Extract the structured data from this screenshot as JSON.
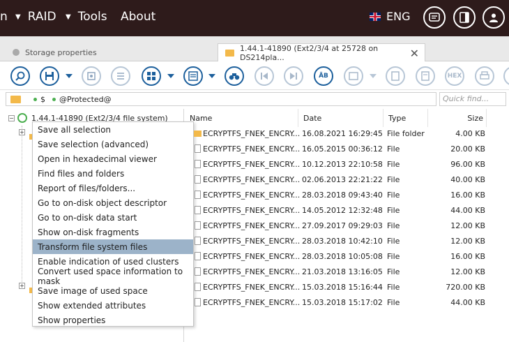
{
  "menubar": {
    "partial_item": "n",
    "items": [
      {
        "label": "RAID",
        "has_caret": true
      },
      {
        "label": "Tools",
        "has_caret": true
      },
      {
        "label": "About",
        "has_caret": false
      }
    ],
    "language": "ENG",
    "buttons": [
      "chat-icon",
      "panel-toggle-icon",
      "user-icon"
    ]
  },
  "tabs": [
    {
      "label": "Storage properties",
      "active": false
    },
    {
      "label": "1.44.1-41890 (Ext2/3/4 at 25728 on DS214pla...",
      "active": true
    }
  ],
  "toolbar": {
    "hex_label": "HEX",
    "ab_label": "ÄB"
  },
  "pathbar": {
    "segments": [
      "$",
      "@Protected@"
    ]
  },
  "quickfind": {
    "placeholder": "Quick find..."
  },
  "tree": {
    "root_label": "1.44.1-41890 (Ext2/3/4 file system)"
  },
  "context_menu": {
    "items": [
      "Save all selection",
      "Save selection (advanced)",
      "Open in hexadecimal viewer",
      "Find files and folders",
      "Report of files/folders...",
      "Go to on-disk object descriptor",
      "Go to on-disk data start",
      "Show on-disk fragments",
      "Transform file system files",
      "Enable indication of used clusters",
      "Convert used space information to mask",
      "Save image of used space",
      "Show extended attributes",
      "Show properties"
    ],
    "highlighted_index": 8
  },
  "filelist": {
    "columns": [
      "Name",
      "Date",
      "Type",
      "Size"
    ],
    "rows": [
      {
        "name": "ECRYPTFS_FNEK_ENCRY...",
        "date": "16.08.2021 16:29:45",
        "type": "File folder",
        "size": "4.00 KB",
        "icon": "folder"
      },
      {
        "name": "ECRYPTFS_FNEK_ENCRY...",
        "date": "16.05.2015 00:36:12",
        "type": "File",
        "size": "20.00 KB",
        "icon": "file"
      },
      {
        "name": "ECRYPTFS_FNEK_ENCRY...",
        "date": "10.12.2013 22:10:58",
        "type": "File",
        "size": "96.00 KB",
        "icon": "file"
      },
      {
        "name": "ECRYPTFS_FNEK_ENCRY...",
        "date": "02.06.2013 22:21:22",
        "type": "File",
        "size": "40.00 KB",
        "icon": "file"
      },
      {
        "name": "ECRYPTFS_FNEK_ENCRY...",
        "date": "28.03.2018 09:43:40",
        "type": "File",
        "size": "16.00 KB",
        "icon": "file"
      },
      {
        "name": "ECRYPTFS_FNEK_ENCRY...",
        "date": "14.05.2012 12:32:48",
        "type": "File",
        "size": "44.00 KB",
        "icon": "file"
      },
      {
        "name": "ECRYPTFS_FNEK_ENCRY...",
        "date": "27.09.2017 09:29:03",
        "type": "File",
        "size": "12.00 KB",
        "icon": "file"
      },
      {
        "name": "ECRYPTFS_FNEK_ENCRY...",
        "date": "28.03.2018 10:42:10",
        "type": "File",
        "size": "12.00 KB",
        "icon": "file"
      },
      {
        "name": "ECRYPTFS_FNEK_ENCRY...",
        "date": "28.03.2018 10:05:08",
        "type": "File",
        "size": "16.00 KB",
        "icon": "file"
      },
      {
        "name": "ECRYPTFS_FNEK_ENCRY...",
        "date": "21.03.2018 13:16:05",
        "type": "File",
        "size": "12.00 KB",
        "icon": "file"
      },
      {
        "name": "ECRYPTFS_FNEK_ENCRY...",
        "date": "15.03.2018 15:16:44",
        "type": "File",
        "size": "720.00 KB",
        "icon": "file"
      },
      {
        "name": "ECRYPTFS_FNEK_ENCRY...",
        "date": "15.03.2018 15:17:02",
        "type": "File",
        "size": "44.00 KB",
        "icon": "file"
      }
    ]
  },
  "colors": {
    "menubar_bg": "#2e1b1b",
    "accent": "#1c5f9c",
    "highlight": "#9cb3c9",
    "folder": "#f3b94a",
    "status_green": "#4caf50"
  }
}
